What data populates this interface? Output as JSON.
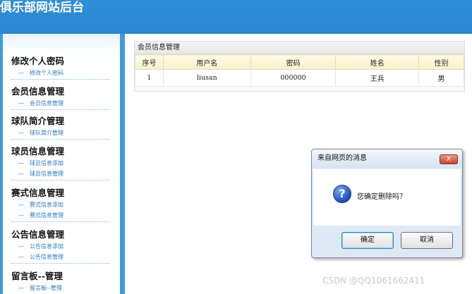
{
  "header": {
    "title": "俱乐部网站后台"
  },
  "sidebar": {
    "groups": [
      {
        "title": "修改个人密码",
        "items": [
          "修改个人密码"
        ]
      },
      {
        "title": "会员信息管理",
        "items": [
          "会员信息管理"
        ]
      },
      {
        "title": "球队简介管理",
        "items": [
          "球队简介管理"
        ]
      },
      {
        "title": "球员信息管理",
        "items": [
          "球员信息添加",
          "球员信息管理"
        ]
      },
      {
        "title": "赛式信息管理",
        "items": [
          "赛式信息添加",
          "赛式信息管理"
        ]
      },
      {
        "title": "公告信息管理",
        "items": [
          "公告信息添加",
          "公告信息管理"
        ]
      },
      {
        "title": "留言板--管理",
        "items": [
          "留言板--管理"
        ]
      }
    ]
  },
  "main": {
    "panel_title": "会员信息管理",
    "table": {
      "columns": [
        "序号",
        "用户名",
        "密码",
        "姓名",
        "性别"
      ],
      "rows": [
        [
          "1",
          "liusan",
          "000000",
          "王兵",
          "男"
        ]
      ]
    }
  },
  "dialog": {
    "title": "来自网页的消息",
    "close_label": "X",
    "message": "您确定删除吗？",
    "icon": "question-icon",
    "ok_label": "确定",
    "cancel_label": "取消"
  },
  "watermark": "CSDN @QQ1061662411"
}
